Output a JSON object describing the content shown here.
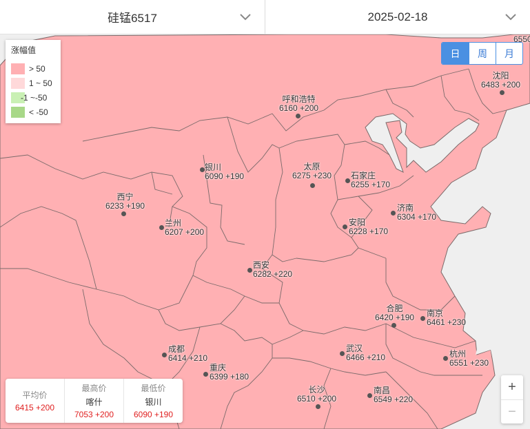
{
  "header": {
    "product": "硅锰6517",
    "date": "2025-02-18"
  },
  "legend": {
    "title": "涨幅值",
    "items": [
      {
        "label": "> 50",
        "color": "#ffb0b3"
      },
      {
        "label": "1 ~ 50",
        "color": "#ffd9da"
      },
      {
        "label": "-1 ~-50",
        "color": "#c9f0b4"
      },
      {
        "label": "< -50",
        "color": "#a8d888"
      }
    ]
  },
  "period": {
    "day": "日",
    "week": "周",
    "month": "月",
    "active": "day"
  },
  "cities": [
    {
      "name": "沈阳",
      "value": "6483 +200"
    },
    {
      "name": "呼和浩特",
      "value": "6160 +200"
    },
    {
      "name": "银川",
      "value": "6090 +190"
    },
    {
      "name": "太原",
      "value": "6275 +230"
    },
    {
      "name": "石家庄",
      "value": "6255 +170"
    },
    {
      "name": "西宁",
      "value": "6233 +190"
    },
    {
      "name": "济南",
      "value": "6304 +170"
    },
    {
      "name": "兰州",
      "value": "6207 +200"
    },
    {
      "name": "安阳",
      "value": "6228 +170"
    },
    {
      "name": "西安",
      "value": "6282 +220"
    },
    {
      "name": "合肥",
      "value": "6420 +190"
    },
    {
      "name": "南京",
      "value": "6461 +230"
    },
    {
      "name": "成都",
      "value": "6414 +210"
    },
    {
      "name": "武汉",
      "value": "6466 +210"
    },
    {
      "name": "杭州",
      "value": "6551 +230"
    },
    {
      "name": "重庆",
      "value": "6399 +180"
    },
    {
      "name": "长沙",
      "value": "6510 +200"
    },
    {
      "name": "南昌",
      "value": "6549 +220"
    },
    {
      "name": "",
      "value": "6550"
    }
  ],
  "stats": {
    "avg": {
      "label": "平均价",
      "value": "6415 +200"
    },
    "max": {
      "label": "最高价",
      "city": "喀什",
      "value": "7053 +200"
    },
    "min": {
      "label": "最低价",
      "city": "银川",
      "value": "6090 +190"
    }
  },
  "zoom": {
    "in": "+",
    "out": "−"
  },
  "colors": {
    "region_fill": "#ffb0b3",
    "border": "#7a6a6a",
    "accent": "#4a90e2",
    "price": "#e02020"
  }
}
